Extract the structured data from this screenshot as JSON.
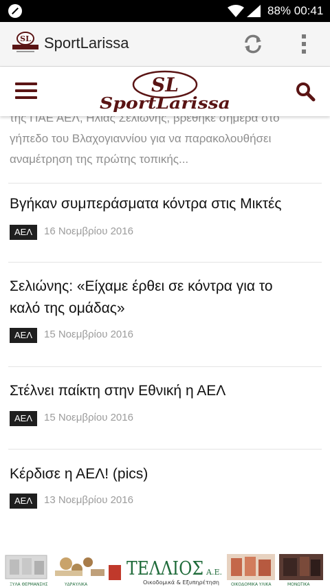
{
  "status_bar": {
    "battery": "88%",
    "time": "00:41"
  },
  "app_bar": {
    "title": "SportLarissa"
  },
  "site_header": {
    "logo_initials": "SL",
    "logo_wordmark": "SportLarissa"
  },
  "feed": {
    "excerpt_lines": [
      "της ΠΑΕ ΑΕΛ, Ηλίας Σελιώνης, βρέθηκε σήμερα στο",
      "γήπεδο του Βλαχογιαννίου για να παρακολουθήσει",
      "αναμέτρηση της πρώτης τοπικής..."
    ],
    "articles": [
      {
        "title_lines": [
          "Βγήκαν συμπεράσματα κόντρα στις Μικτές"
        ],
        "category": "ΑΕΛ",
        "date": "16 Νοεμβρίου 2016"
      },
      {
        "title_lines": [
          "Σελιώνης: «Είχαμε έρθει σε κόντρα για το",
          "καλό της ομάδας»"
        ],
        "category": "ΑΕΛ",
        "date": "15 Νοεμβρίου 2016"
      },
      {
        "title_lines": [
          "Στέλνει παίκτη στην Εθνική η ΑΕΛ"
        ],
        "category": "ΑΕΛ",
        "date": "15 Νοεμβρίου 2016"
      },
      {
        "title_lines": [
          "Κέρδισε η ΑΕΛ! (pics)"
        ],
        "category": "ΑΕΛ",
        "date": "13 Νοεμβρίου 2016"
      }
    ]
  },
  "ad_banner": {
    "brand": "ΤΕΛΛΙΟΣ",
    "brand_suffix": "Α.Ε.",
    "tagline": "Οικοδομικά & Εξυπηρέτηση",
    "product_labels": [
      "ΞΥΛΑ ΘΕΡΜΑΝΣΗΣ",
      "ΥΔΡΑΥΛΙΚΑ",
      "ΟΙΚΟΔΟΜΙΚΑ ΥΛΙΚΑ",
      "ΜΟΝΩΤΙΚΑ"
    ]
  },
  "colors": {
    "status_bar": "#000000",
    "app_bar": "#f5f5f5",
    "brand_dark_red": "#5a1414",
    "category_badge": "#1f1f1f",
    "banner_green": "#1f6b3a"
  },
  "icons": {
    "status_left": "no-sim-icon",
    "wifi": "wifi-icon",
    "signal": "signal-icon",
    "refresh": "refresh-icon",
    "more": "more-vert-icon",
    "menu": "hamburger-menu-icon",
    "search": "search-icon"
  }
}
